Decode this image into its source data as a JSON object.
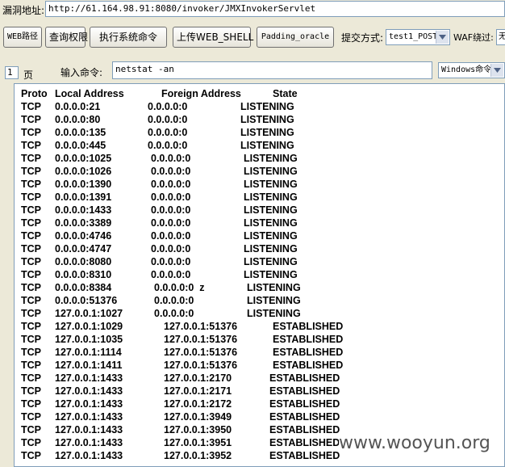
{
  "toolbar": {
    "url_label": "漏洞地址:",
    "url_value": "http://61.164.98.91:8080/invoker/JMXInvokerServlet",
    "buttons": {
      "web_path": "WEB路径",
      "query_perm": "查询权限",
      "exec_cmd": "执行系统命令",
      "upload_shell": "上传WEB_SHELL",
      "padding_oracle": "Padding_oracle"
    },
    "submit_label": "提交方式:",
    "submit_value": "test1_POST",
    "waf_label": "WAF绕过:",
    "waf_value": "无"
  },
  "command_bar": {
    "page_value": "1",
    "page_label": "页",
    "cmd_label": "输入命令:",
    "cmd_value": "netstat -an",
    "os_value": "Windows命令"
  },
  "netstat": {
    "headers": [
      "Proto",
      "Local Address",
      "Foreign Address",
      "State"
    ],
    "rows": [
      [
        "TCP",
        "0.0.0.0:21",
        "0.0.0.0:0",
        "LISTENING"
      ],
      [
        "TCP",
        "0.0.0.0:80",
        "0.0.0.0:0",
        "LISTENING"
      ],
      [
        "TCP",
        "0.0.0.0:135",
        "0.0.0.0:0",
        "LISTENING"
      ],
      [
        "TCP",
        "0.0.0.0:445",
        "0.0.0.0:0",
        "LISTENING"
      ],
      [
        "TCP",
        "0.0.0.0:1025",
        "0.0.0.0:0",
        "LISTENING"
      ],
      [
        "TCP",
        "0.0.0.0:1026",
        "0.0.0.0:0",
        "LISTENING"
      ],
      [
        "TCP",
        "0.0.0.0:1390",
        "0.0.0.0:0",
        "LISTENING"
      ],
      [
        "TCP",
        "0.0.0.0:1391",
        "0.0.0.0:0",
        "LISTENING"
      ],
      [
        "TCP",
        "0.0.0.0:1433",
        "0.0.0.0:0",
        "LISTENING"
      ],
      [
        "TCP",
        "0.0.0.0:3389",
        "0.0.0.0:0",
        "LISTENING"
      ],
      [
        "TCP",
        "0.0.0.0:4746",
        "0.0.0.0:0",
        "LISTENING"
      ],
      [
        "TCP",
        "0.0.0.0:4747",
        "0.0.0.0:0",
        "LISTENING"
      ],
      [
        "TCP",
        "0.0.0.0:8080",
        "0.0.0.0:0",
        "LISTENING"
      ],
      [
        "TCP",
        "0.0.0.0:8310",
        "0.0.0.0:0",
        "LISTENING"
      ],
      [
        "TCP",
        "0.0.0.0:8384",
        "0.0.0.0:0  z",
        "LISTENING"
      ],
      [
        "TCP",
        "0.0.0.0:51376",
        "0.0.0.0:0",
        "LISTENING"
      ],
      [
        "TCP",
        "127.0.0.1:1027",
        "0.0.0.0:0",
        "LISTENING"
      ],
      [
        "TCP",
        "127.0.0.1:1029",
        "127.0.0.1:51376",
        "ESTABLISHED"
      ],
      [
        "TCP",
        "127.0.0.1:1035",
        "127.0.0.1:51376",
        "ESTABLISHED"
      ],
      [
        "TCP",
        "127.0.0.1:1114",
        "127.0.0.1:51376",
        "ESTABLISHED"
      ],
      [
        "TCP",
        "127.0.0.1:1411",
        "127.0.0.1:51376",
        "ESTABLISHED"
      ],
      [
        "TCP",
        "127.0.0.1:1433",
        "127.0.0.1:2170",
        "ESTABLISHED"
      ],
      [
        "TCP",
        "127.0.0.1:1433",
        "127.0.0.1:2171",
        "ESTABLISHED"
      ],
      [
        "TCP",
        "127.0.0.1:1433",
        "127.0.0.1:2172",
        "ESTABLISHED"
      ],
      [
        "TCP",
        "127.0.0.1:1433",
        "127.0.0.1:3949",
        "ESTABLISHED"
      ],
      [
        "TCP",
        "127.0.0.1:1433",
        "127.0.0.1:3950",
        "ESTABLISHED"
      ],
      [
        "TCP",
        "127.0.0.1:1433",
        "127.0.0.1:3951",
        "ESTABLISHED"
      ],
      [
        "TCP",
        "127.0.0.1:1433",
        "127.0.0.1:3952",
        "ESTABLISHED"
      ]
    ]
  },
  "watermark": "www.wooyun.org",
  "icons": {
    "dropdown": "chevron-down-icon"
  }
}
